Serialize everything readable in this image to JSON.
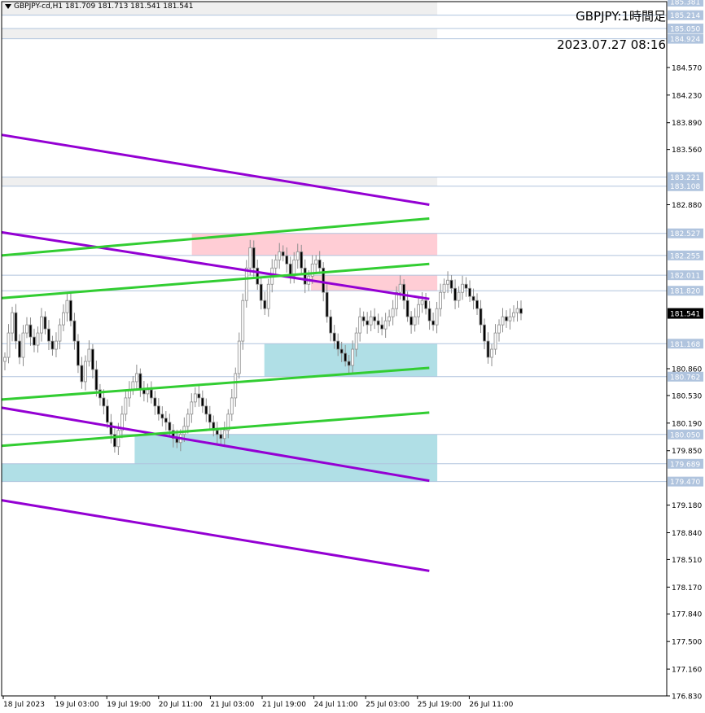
{
  "header": {
    "symbol_line": "GBPJPY-cd,H1  181.709 181.713 181.541 181.541",
    "title": "GBPJPY:1時間足",
    "timestamp": "2023.07.27 08:16"
  },
  "colors": {
    "resistance_zone": "#ffcdd5",
    "support_zone": "#b0dfe6",
    "trend_purple": "#9400d3",
    "trend_green": "#32cd32",
    "bid_label_bg": "#000000",
    "level_label_bg": "#b0c4de",
    "candle_body": "#ffffff",
    "candle_outline": "#8c8c8c"
  },
  "chart_data": {
    "type": "candlestick",
    "title": "GBPJPY:1時間足",
    "ylim": [
      176.83,
      185.381
    ],
    "current_price": "181.541",
    "price_axis_ticks": [
      "184.570",
      "184.230",
      "183.890",
      "183.560",
      "182.880",
      "180.860",
      "180.530",
      "180.190",
      "179.850",
      "179.180",
      "178.840",
      "178.510",
      "178.170",
      "177.840",
      "177.500",
      "177.160",
      "176.830"
    ],
    "highlight_levels": [
      "185.381",
      "185.214",
      "185.050",
      "184.924",
      "183.221",
      "183.108",
      "182.527",
      "182.255",
      "182.011",
      "181.820",
      "181.168",
      "180.762",
      "180.050",
      "179.689",
      "179.470"
    ],
    "time_axis_labels": [
      "18 Jul 2023",
      "19 Jul 03:00",
      "19 Jul 19:00",
      "20 Jul 11:00",
      "21 Jul 03:00",
      "21 Jul 19:00",
      "24 Jul 11:00",
      "25 Jul 03:00",
      "25 Jul 19:00",
      "26 Jul 11:00"
    ],
    "zones": [
      {
        "kind": "resistance",
        "x0": 0.286,
        "x1": 0.655,
        "top": 182.527,
        "bottom": 182.255
      },
      {
        "kind": "resistance",
        "x0": 0.465,
        "x1": 0.655,
        "top": 182.011,
        "bottom": 181.82
      },
      {
        "kind": "support",
        "x0": 0.395,
        "x1": 0.655,
        "top": 181.168,
        "bottom": 180.762
      },
      {
        "kind": "support",
        "x0": 0.2,
        "x1": 0.655,
        "top": 180.05,
        "bottom": 179.689
      },
      {
        "kind": "support",
        "x0": 0.0,
        "x1": 0.655,
        "top": 179.689,
        "bottom": 179.47
      },
      {
        "kind": "gray",
        "x0": 0.0,
        "x1": 0.655,
        "top": 185.381,
        "bottom": 185.214
      },
      {
        "kind": "gray",
        "x0": 0.0,
        "x1": 0.655,
        "top": 185.05,
        "bottom": 184.924
      },
      {
        "kind": "gray",
        "x0": 0.0,
        "x1": 0.655,
        "top": 183.221,
        "bottom": 183.108
      }
    ],
    "trendlines": [
      {
        "color": "purple",
        "x0": 0.0,
        "y0": 183.74,
        "x1": 0.643,
        "y1": 182.88
      },
      {
        "color": "purple",
        "x0": 0.0,
        "y0": 182.54,
        "x1": 0.643,
        "y1": 181.72
      },
      {
        "color": "purple",
        "x0": 0.0,
        "y0": 180.38,
        "x1": 0.643,
        "y1": 179.48
      },
      {
        "color": "purple",
        "x0": 0.0,
        "y0": 179.24,
        "x1": 0.643,
        "y1": 178.37
      },
      {
        "color": "green",
        "x0": 0.0,
        "y0": 182.255,
        "x1": 0.643,
        "y1": 182.71
      },
      {
        "color": "green",
        "x0": 0.0,
        "y0": 181.73,
        "x1": 0.643,
        "y1": 182.15
      },
      {
        "color": "green",
        "x0": 0.0,
        "y0": 180.48,
        "x1": 0.643,
        "y1": 180.87
      },
      {
        "color": "green",
        "x0": 0.0,
        "y0": 179.91,
        "x1": 0.643,
        "y1": 180.32
      }
    ],
    "closes": [
      181.0,
      181.3,
      181.55,
      181.2,
      181.0,
      181.3,
      181.4,
      181.25,
      181.15,
      181.3,
      181.5,
      181.35,
      181.2,
      181.1,
      181.2,
      181.4,
      181.55,
      181.7,
      181.45,
      181.2,
      180.9,
      180.7,
      180.95,
      181.1,
      180.85,
      180.6,
      180.5,
      180.4,
      180.2,
      180.05,
      179.9,
      180.1,
      180.3,
      180.5,
      180.6,
      180.7,
      180.8,
      180.6,
      180.55,
      180.6,
      180.5,
      180.4,
      180.3,
      180.25,
      180.2,
      180.1,
      180.0,
      179.95,
      180.05,
      180.15,
      180.3,
      180.45,
      180.55,
      180.5,
      180.4,
      180.3,
      180.2,
      180.1,
      180.05,
      180.0,
      180.1,
      180.3,
      180.5,
      180.8,
      181.2,
      181.7,
      182.1,
      182.35,
      182.1,
      181.9,
      181.7,
      181.6,
      181.9,
      182.1,
      182.2,
      182.3,
      182.25,
      182.15,
      182.0,
      182.2,
      182.3,
      182.1,
      181.9,
      182.0,
      182.15,
      182.2,
      182.1,
      181.8,
      181.5,
      181.3,
      181.2,
      181.1,
      181.05,
      180.95,
      180.9,
      181.1,
      181.3,
      181.5,
      181.45,
      181.4,
      181.5,
      181.45,
      181.4,
      181.35,
      181.45,
      181.5,
      181.6,
      181.8,
      181.9,
      181.7,
      181.5,
      181.4,
      181.5,
      181.65,
      181.7,
      181.6,
      181.45,
      181.4,
      181.6,
      181.8,
      181.9,
      181.95,
      181.85,
      181.7,
      181.8,
      181.9,
      181.85,
      181.75,
      181.7,
      181.6,
      181.4,
      181.2,
      181.0,
      181.1,
      181.3,
      181.4,
      181.5,
      181.45,
      181.5,
      181.55,
      181.6,
      181.541
    ]
  }
}
